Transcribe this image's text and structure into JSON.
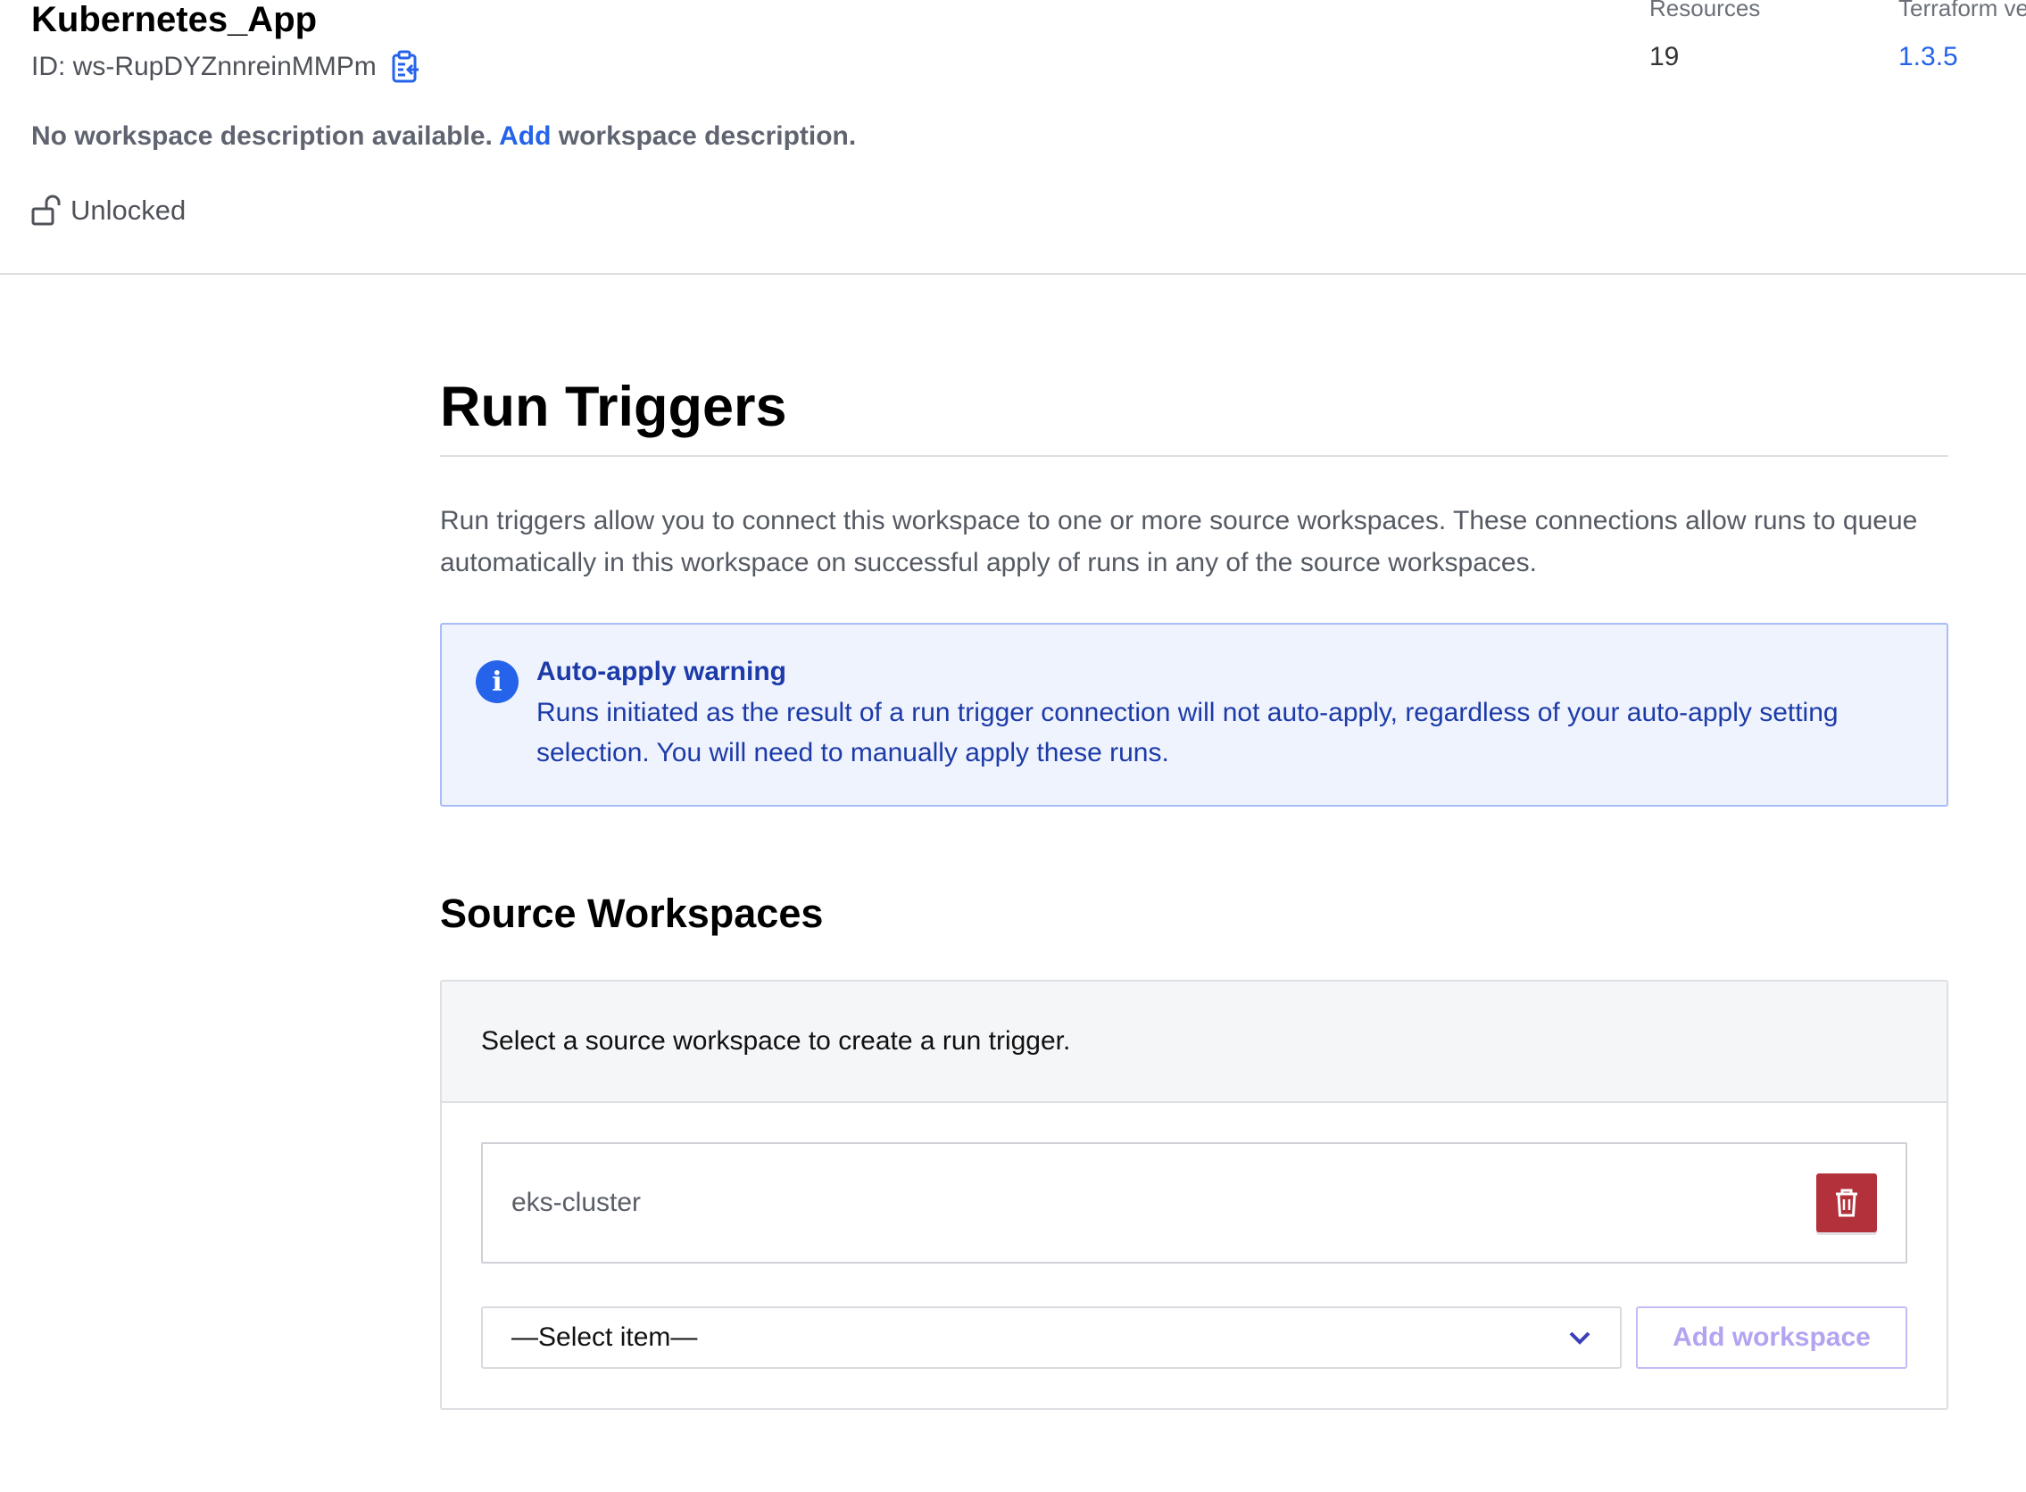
{
  "workspace": {
    "title": "Kubernetes_App",
    "id_label": "ID: ws-RupDYZnnreinMMPm",
    "description_prefix": "No workspace description available.",
    "description_link": "Add",
    "description_suffix": "workspace description.",
    "lock_status": "Unlocked"
  },
  "stats": {
    "resources_label": "Resources",
    "resources_value": "19",
    "terraform_label": "Terraform ve",
    "terraform_value": "1.3.5"
  },
  "run_triggers": {
    "title": "Run Triggers",
    "intro": "Run triggers allow you to connect this workspace to one or more source workspaces. These connections allow runs to queue automatically in this workspace on successful apply of runs in any of the source workspaces.",
    "alert_title": "Auto-apply warning",
    "alert_body": "Runs initiated as the result of a run trigger connection will not auto-apply, regardless of your auto-apply setting selection. You will need to manually apply these runs."
  },
  "source_workspaces": {
    "title": "Source Workspaces",
    "panel_head": "Select a source workspace to create a run trigger.",
    "items": [
      {
        "name": "eks-cluster"
      }
    ],
    "select_value": "—Select item—",
    "add_button": "Add workspace"
  },
  "colors": {
    "link": "#2563eb",
    "alert_text": "#1d3ba8",
    "danger": "#b2313b",
    "add_button_text": "#b4a3f1"
  }
}
